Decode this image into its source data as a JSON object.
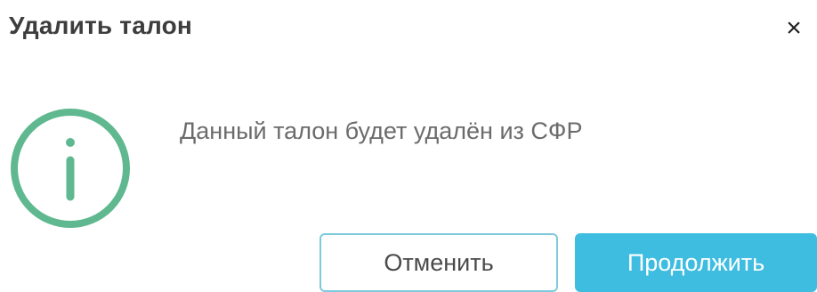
{
  "dialog": {
    "title": "Удалить талон",
    "close_glyph": "×",
    "message": "Данный талон будет удалён из СФР",
    "icon": "info-circle-icon",
    "buttons": {
      "cancel_label": "Отменить",
      "continue_label": "Продолжить"
    }
  },
  "colors": {
    "icon_green": "#5fb88f",
    "primary_button": "#3fbde0",
    "secondary_border": "#7ec9dc",
    "title_text": "#3d3d3d",
    "message_text": "#6b6b6b"
  }
}
